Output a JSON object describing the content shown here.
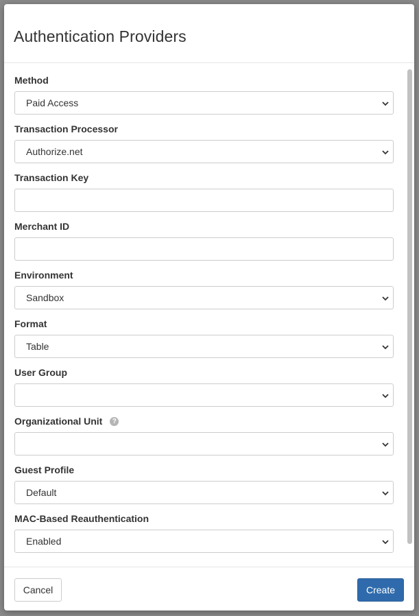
{
  "modal": {
    "title": "Authentication Providers"
  },
  "form": {
    "fields": [
      {
        "label": "Method",
        "type": "select",
        "value": "Paid Access"
      },
      {
        "label": "Transaction Processor",
        "type": "select",
        "value": "Authorize.net"
      },
      {
        "label": "Transaction Key",
        "type": "input",
        "value": ""
      },
      {
        "label": "Merchant ID",
        "type": "input",
        "value": ""
      },
      {
        "label": "Environment",
        "type": "select",
        "value": "Sandbox"
      },
      {
        "label": "Format",
        "type": "select",
        "value": "Table"
      },
      {
        "label": "User Group",
        "type": "select",
        "value": ""
      },
      {
        "label": "Organizational Unit",
        "type": "select",
        "value": "",
        "help": "?"
      },
      {
        "label": "Guest Profile",
        "type": "select",
        "value": "Default"
      },
      {
        "label": "MAC-Based Reauthentication",
        "type": "select",
        "value": "Enabled"
      }
    ]
  },
  "footer": {
    "cancel_label": "Cancel",
    "create_label": "Create"
  },
  "colors": {
    "primary": "#2f6bac",
    "border": "#cccccc",
    "text": "#333333"
  }
}
